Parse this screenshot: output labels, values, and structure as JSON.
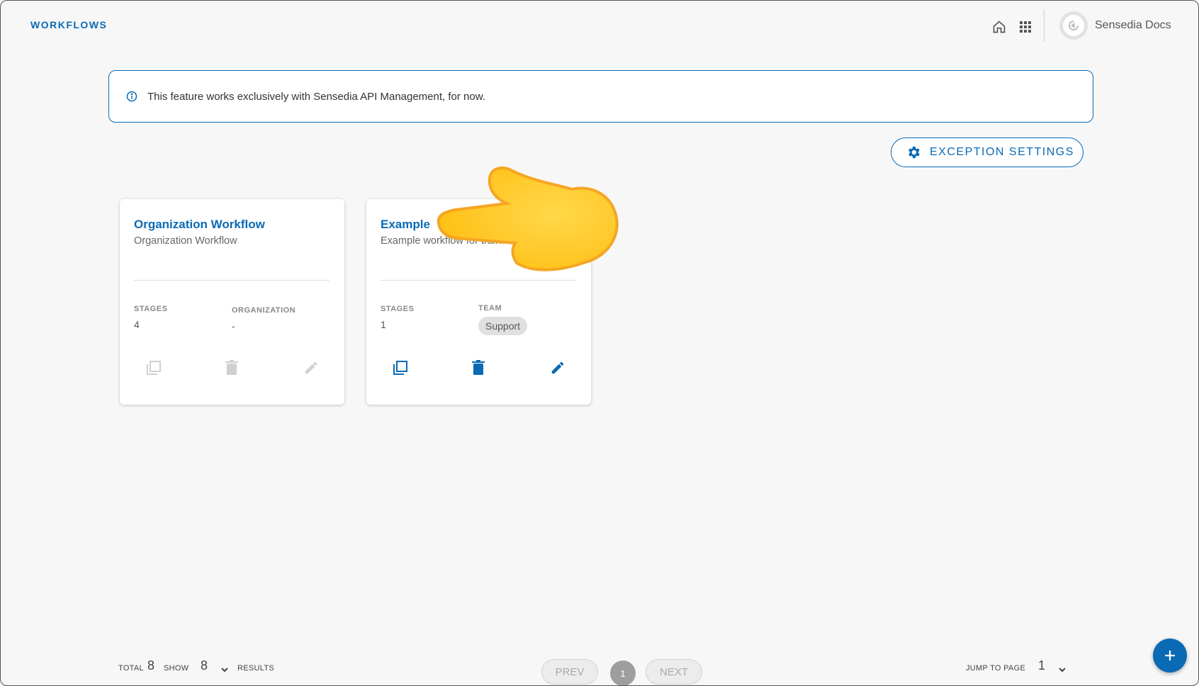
{
  "header": {
    "title": "WORKFLOWS",
    "user_name": "Sensedia Docs",
    "icons": [
      "home-icon",
      "apps-grid-icon"
    ]
  },
  "banner": {
    "text": "This feature works exclusively with Sensedia API Management, for now.",
    "icon": "info-icon"
  },
  "exception_button": {
    "label": "EXCEPTION SETTINGS",
    "icon": "gear-icon"
  },
  "cards": [
    {
      "title": "Organization Workflow",
      "description": "Organization Workflow",
      "stages_label": "STAGES",
      "stages_value": "4",
      "scope_label": "ORGANIZATION",
      "scope_value": "-",
      "actions_enabled": false
    },
    {
      "title": "Example",
      "description": "Example workflow for traini",
      "stages_label": "STAGES",
      "stages_value": "1",
      "scope_label": "TEAM",
      "scope_chip": "Support",
      "actions_enabled": true
    }
  ],
  "footer": {
    "total_label": "TOTAL",
    "total_value": "8",
    "show_label": "SHOW",
    "show_value": "8",
    "results_label": "RESULTS",
    "prev_label": "PREV",
    "current_page": "1",
    "next_label": "NEXT",
    "jump_label": "JUMP TO PAGE",
    "jump_value": "1"
  },
  "colors": {
    "accent": "#0a6ab4",
    "background": "#f7f7f7",
    "disabled": "#d0d0d0"
  }
}
